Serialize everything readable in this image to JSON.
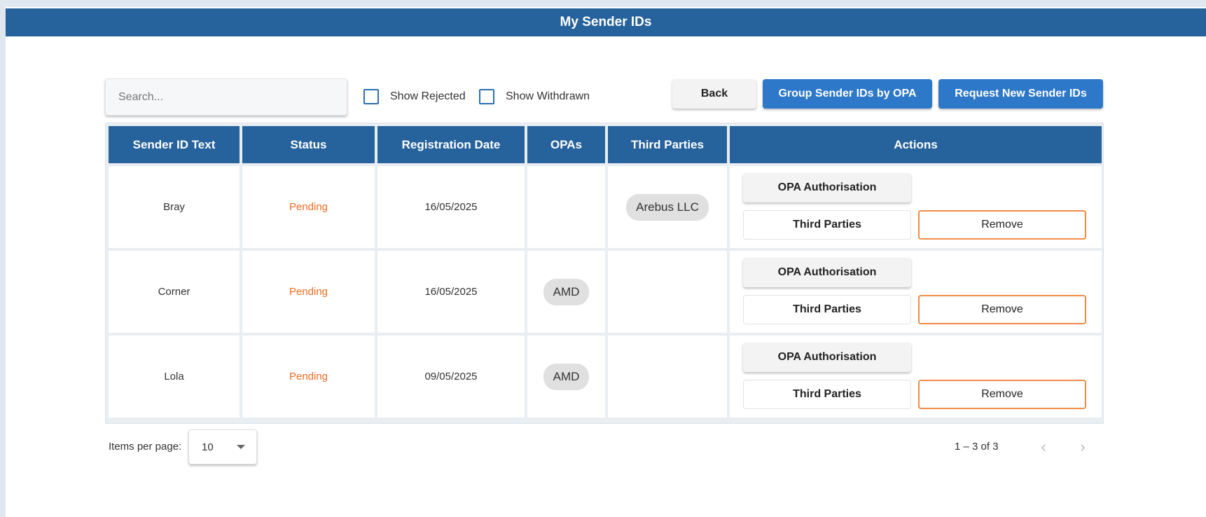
{
  "header": {
    "title": "My Sender IDs"
  },
  "toolbar": {
    "search_placeholder": "Search...",
    "show_rejected_label": "Show Rejected",
    "show_withdrawn_label": "Show Withdrawn",
    "back_label": "Back",
    "group_label": "Group Sender IDs by OPA",
    "request_label": "Request New Sender IDs"
  },
  "table": {
    "columns": [
      "Sender ID Text",
      "Status",
      "Registration Date",
      "OPAs",
      "Third Parties",
      "Actions"
    ],
    "rows": [
      {
        "sender": "Bray",
        "status": "Pending",
        "date": "16/05/2025",
        "opa": "",
        "third_party": "Arebus LLC"
      },
      {
        "sender": "Corner",
        "status": "Pending",
        "date": "16/05/2025",
        "opa": "AMD",
        "third_party": ""
      },
      {
        "sender": "Lola",
        "status": "Pending",
        "date": "09/05/2025",
        "opa": "AMD",
        "third_party": ""
      }
    ],
    "action_labels": {
      "opa_auth": "OPA Authorisation",
      "third_parties": "Third Parties",
      "remove": "Remove"
    }
  },
  "pagination": {
    "items_per_page_label": "Items per page:",
    "items_per_page_value": "10",
    "range_label": "1 – 3 of 3",
    "prev_icon": "chevron-left-icon",
    "next_icon": "chevron-right-icon"
  },
  "colors": {
    "header_bg": "#26629c",
    "primary_button": "#2e78c9",
    "status_pending": "#f06a1e",
    "remove_border": "#f28a45"
  }
}
